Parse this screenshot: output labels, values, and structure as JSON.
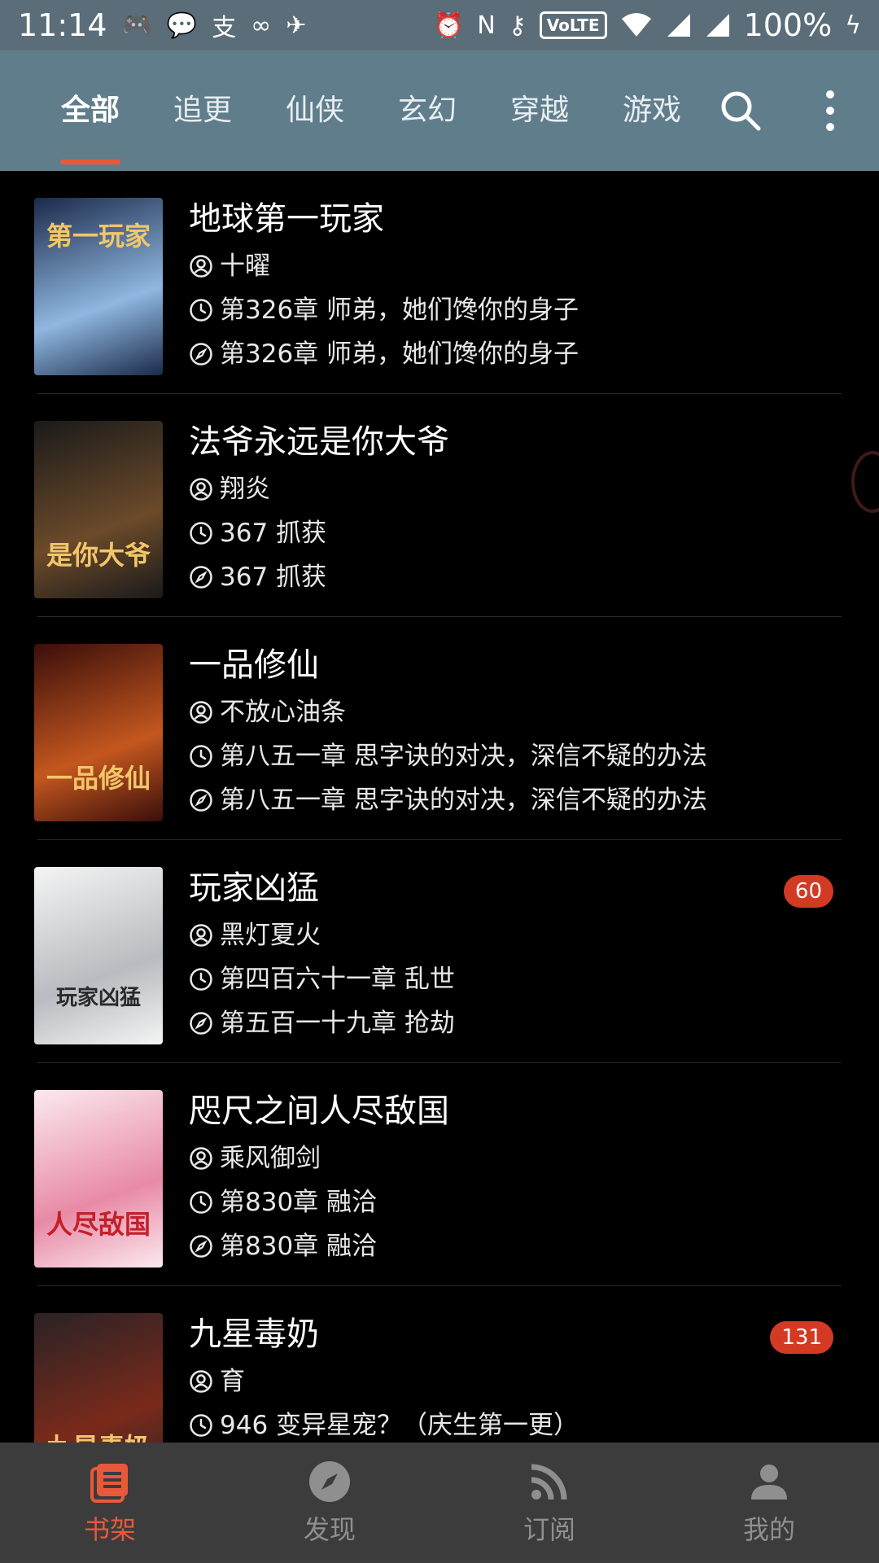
{
  "status_bar": {
    "time": "11:14",
    "battery": "100%",
    "volte": "VoLTE"
  },
  "tabs": [
    {
      "label": "全部",
      "active": true
    },
    {
      "label": "追更",
      "active": false
    },
    {
      "label": "仙侠",
      "active": false
    },
    {
      "label": "玄幻",
      "active": false
    },
    {
      "label": "穿越",
      "active": false
    },
    {
      "label": "游戏",
      "active": false
    }
  ],
  "books": [
    {
      "title": "地球第一玩家",
      "author": "十曜",
      "latest": "第326章 师弟，她们馋你的身子",
      "read": "第326章 师弟，她们馋你的身子",
      "badge": "",
      "cover_text": "第一玩家",
      "cover_colors": [
        "#1b2a4a",
        "#8fb7e0"
      ]
    },
    {
      "title": "法爷永远是你大爷",
      "author": "翔炎",
      "latest": "367 抓获",
      "read": "367 抓获",
      "badge": "",
      "cover_text": "是你大爷",
      "cover_colors": [
        "#1a1a1a",
        "#6b4a2a"
      ]
    },
    {
      "title": "一品修仙",
      "author": "不放心油条",
      "latest": "第八五一章 思字诀的对决，深信不疑的办法",
      "read": "第八五一章 思字诀的对决，深信不疑的办法",
      "badge": "",
      "cover_text": "一品修仙",
      "cover_colors": [
        "#3a0e0a",
        "#c4571f"
      ]
    },
    {
      "title": "玩家凶猛",
      "author": "黑灯夏火",
      "latest": "第四百六十一章 乱世",
      "read": "第五百一十九章 抢劫",
      "badge": "60",
      "cover_text": "玩家凶猛",
      "cover_colors": [
        "#f4f4f4",
        "#b8bcc0"
      ]
    },
    {
      "title": "咫尺之间人尽敌国",
      "author": "乘风御剑",
      "latest": "第830章 融洽",
      "read": "第830章 融洽",
      "badge": "",
      "cover_text": "人尽敌国",
      "cover_colors": [
        "#fbe9ef",
        "#e88aa6"
      ]
    },
    {
      "title": "九星毒奶",
      "author": "育",
      "latest": "946 变异星宠？（庆生第一更）",
      "read": "",
      "badge": "131",
      "cover_text": "九星毒奶",
      "cover_colors": [
        "#2a2226",
        "#7a2a1a"
      ]
    }
  ],
  "bottom_nav": [
    {
      "label": "书架",
      "icon": "bookshelf-icon",
      "active": true
    },
    {
      "label": "发现",
      "icon": "compass-icon",
      "active": false
    },
    {
      "label": "订阅",
      "icon": "rss-icon",
      "active": false
    },
    {
      "label": "我的",
      "icon": "person-icon",
      "active": false
    }
  ],
  "colors": {
    "accent": "#e8583b",
    "header": "#607d8b",
    "badge": "#d33a24",
    "background": "#000000"
  }
}
